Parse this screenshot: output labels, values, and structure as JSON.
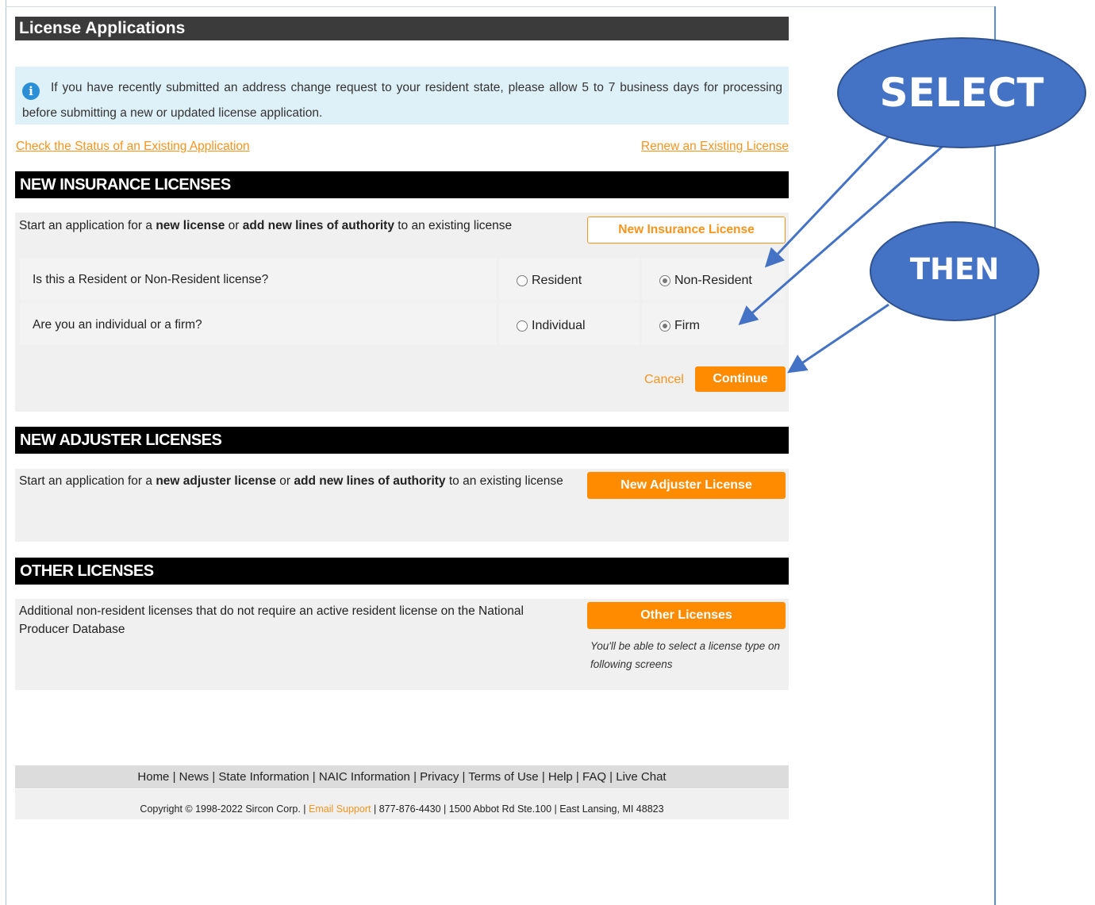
{
  "page": {
    "title": "License Applications"
  },
  "notice": {
    "text": "If you have recently submitted an address change request to your resident state, please allow 5 to 7 business days for processing before submitting a new or updated license application."
  },
  "links": {
    "check_status": "Check the Status of an Existing Application",
    "renew": "Renew an Existing License"
  },
  "insurance": {
    "heading": "NEW INSURANCE LICENSES",
    "desc_pre": "Start an application for a ",
    "desc_b1": "new license",
    "desc_mid": " or ",
    "desc_b2": "add new lines of authority",
    "desc_post": " to an existing license",
    "button": "New Insurance License",
    "q1": "Is this a Resident or Non-Resident license?",
    "q1_opt1": "Resident",
    "q1_opt2": "Non-Resident",
    "q1_selected": "Non-Resident",
    "q2": "Are you an individual or a firm?",
    "q2_opt1": "Individual",
    "q2_opt2": "Firm",
    "q2_selected": "Firm",
    "cancel": "Cancel",
    "continue": "Continue"
  },
  "adjuster": {
    "heading": "NEW ADJUSTER LICENSES",
    "desc_pre": "Start an application for a ",
    "desc_b1": "new adjuster license",
    "desc_mid": " or ",
    "desc_b2": "add new lines of authority",
    "desc_post": " to an existing license",
    "button": "New Adjuster License"
  },
  "other": {
    "heading": "OTHER LICENSES",
    "desc": "Additional non-resident licenses that do not require an active resident license on the National Producer Database",
    "button": "Other Licenses",
    "note": "You'll be able to select a license type on following screens"
  },
  "footer": {
    "nav": [
      "Home",
      "News",
      "State Information",
      "NAIC Information",
      "Privacy",
      "Terms of Use",
      "Help",
      "FAQ",
      "Live Chat"
    ],
    "copyright": "Copyright © 1998-2022 Sircon Corp.",
    "email": "Email Support",
    "contact": "877-876-4430 | 1500 Abbot Rd Ste.100 | East Lansing, MI 48823"
  },
  "annotations": {
    "select": "SELECT",
    "then": "THEN",
    "color": "#4472c4"
  }
}
